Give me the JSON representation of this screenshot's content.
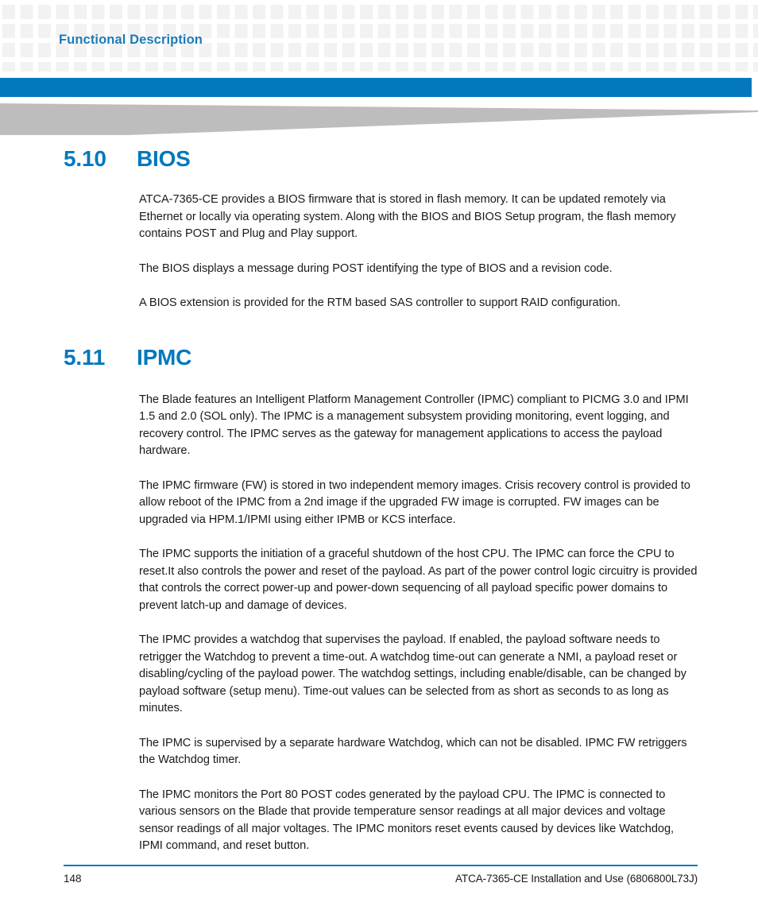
{
  "header": {
    "title": "Functional Description",
    "accent_color": "#0378bd",
    "title_color": "#1b7ab5",
    "pattern_square_color": "#f2f2f2",
    "swoosh_color": "#bdbdbd"
  },
  "sections": [
    {
      "number": "5.10",
      "title": "BIOS",
      "paragraphs": [
        "ATCA-7365-CE provides a BIOS firmware that is stored in flash memory. It can be updated remotely via Ethernet or locally via operating system. Along with the BIOS and BIOS Setup program, the flash memory contains POST and Plug and Play support.",
        "The BIOS displays a message during POST identifying the type of BIOS and a revision code.",
        "A BIOS extension is provided for the RTM based SAS controller to support RAID configuration."
      ]
    },
    {
      "number": "5.11",
      "title": "IPMC",
      "paragraphs": [
        "The Blade features an Intelligent Platform Management Controller (IPMC) compliant to PICMG 3.0 and IPMI 1.5 and 2.0 (SOL only). The IPMC is a management subsystem providing monitoring, event logging, and recovery control. The IPMC serves as the gateway for management applications to access the payload hardware.",
        "The IPMC firmware (FW) is stored in two independent memory images. Crisis recovery control is provided to allow reboot of the IPMC from a 2nd image if the upgraded FW image is corrupted. FW images can be upgraded via HPM.1/IPMI using either IPMB or KCS interface.",
        "The IPMC supports the initiation of a graceful shutdown of the host CPU. The IPMC can force the CPU to reset.It also controls the power and reset of the payload. As part of the power control logic circuitry is provided that controls the correct power-up and power-down sequencing of all payload specific power domains to prevent latch-up and damage of devices.",
        "The IPMC provides a watchdog that supervises the payload. If enabled, the payload software needs to retrigger the Watchdog to prevent a time-out. A watchdog time-out can generate a NMI, a payload reset or disabling/cycling of the payload power. The watchdog settings, including enable/disable, can be changed by payload software (setup menu). Time-out values can be selected from as short as seconds to as long as minutes.",
        "The IPMC is supervised by a separate hardware Watchdog, which can not be disabled. IPMC FW retriggers the Watchdog timer.",
        "The IPMC monitors the Port 80 POST codes generated by the payload CPU. The IPMC is connected to various sensors on the Blade that provide temperature sensor readings at all major devices and voltage sensor readings of all major voltages. The IPMC monitors reset events caused by devices like Watchdog, IPMI command, and reset button."
      ]
    }
  ],
  "footer": {
    "page_number": "148",
    "document_title": "ATCA-7365-CE Installation and Use (6806800L73J)"
  }
}
